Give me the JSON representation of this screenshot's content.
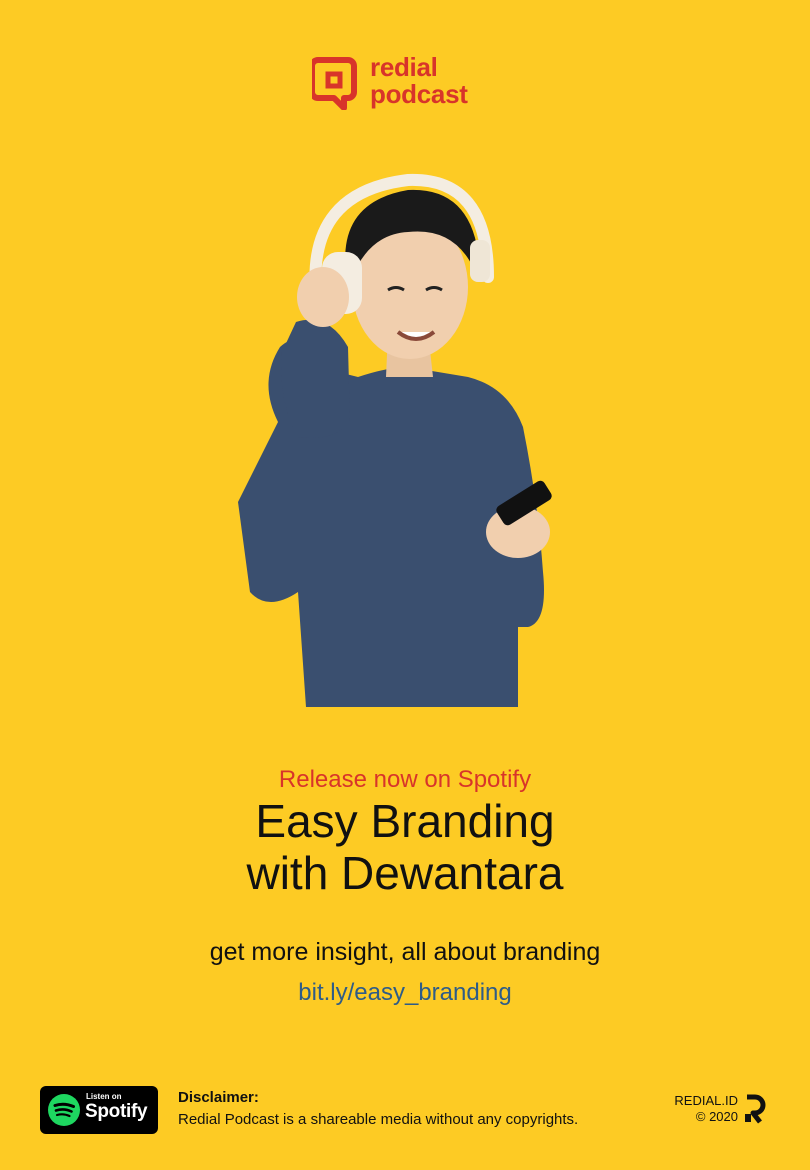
{
  "logo": {
    "line1": "redial",
    "line2": "podcast",
    "mark_icon": "redial-chat-bubble-icon",
    "color": "#D8342A"
  },
  "hero": {
    "subject": "man with headphones using phone"
  },
  "headline": {
    "release": "Release now on Spotify",
    "title_line1": "Easy Branding",
    "title_line2": "with Dewantara"
  },
  "body": {
    "insight": "get more insight, all about branding",
    "link": "bit.ly/easy_branding"
  },
  "footer": {
    "spotify_badge": {
      "small": "Listen on",
      "big": "Spotify",
      "icon": "spotify-icon",
      "color": "#1ED760"
    },
    "disclaimer_title": "Disclaimer:",
    "disclaimer_text": "Redial Podcast is a shareable media without any copyrights.",
    "brand_line1": "REDIAL.ID",
    "brand_line2": "© 2020",
    "brand_icon": "redial-r-icon"
  },
  "colors": {
    "background": "#FDCB24",
    "accent_red": "#D8342A",
    "link_blue": "#2E5C88"
  }
}
